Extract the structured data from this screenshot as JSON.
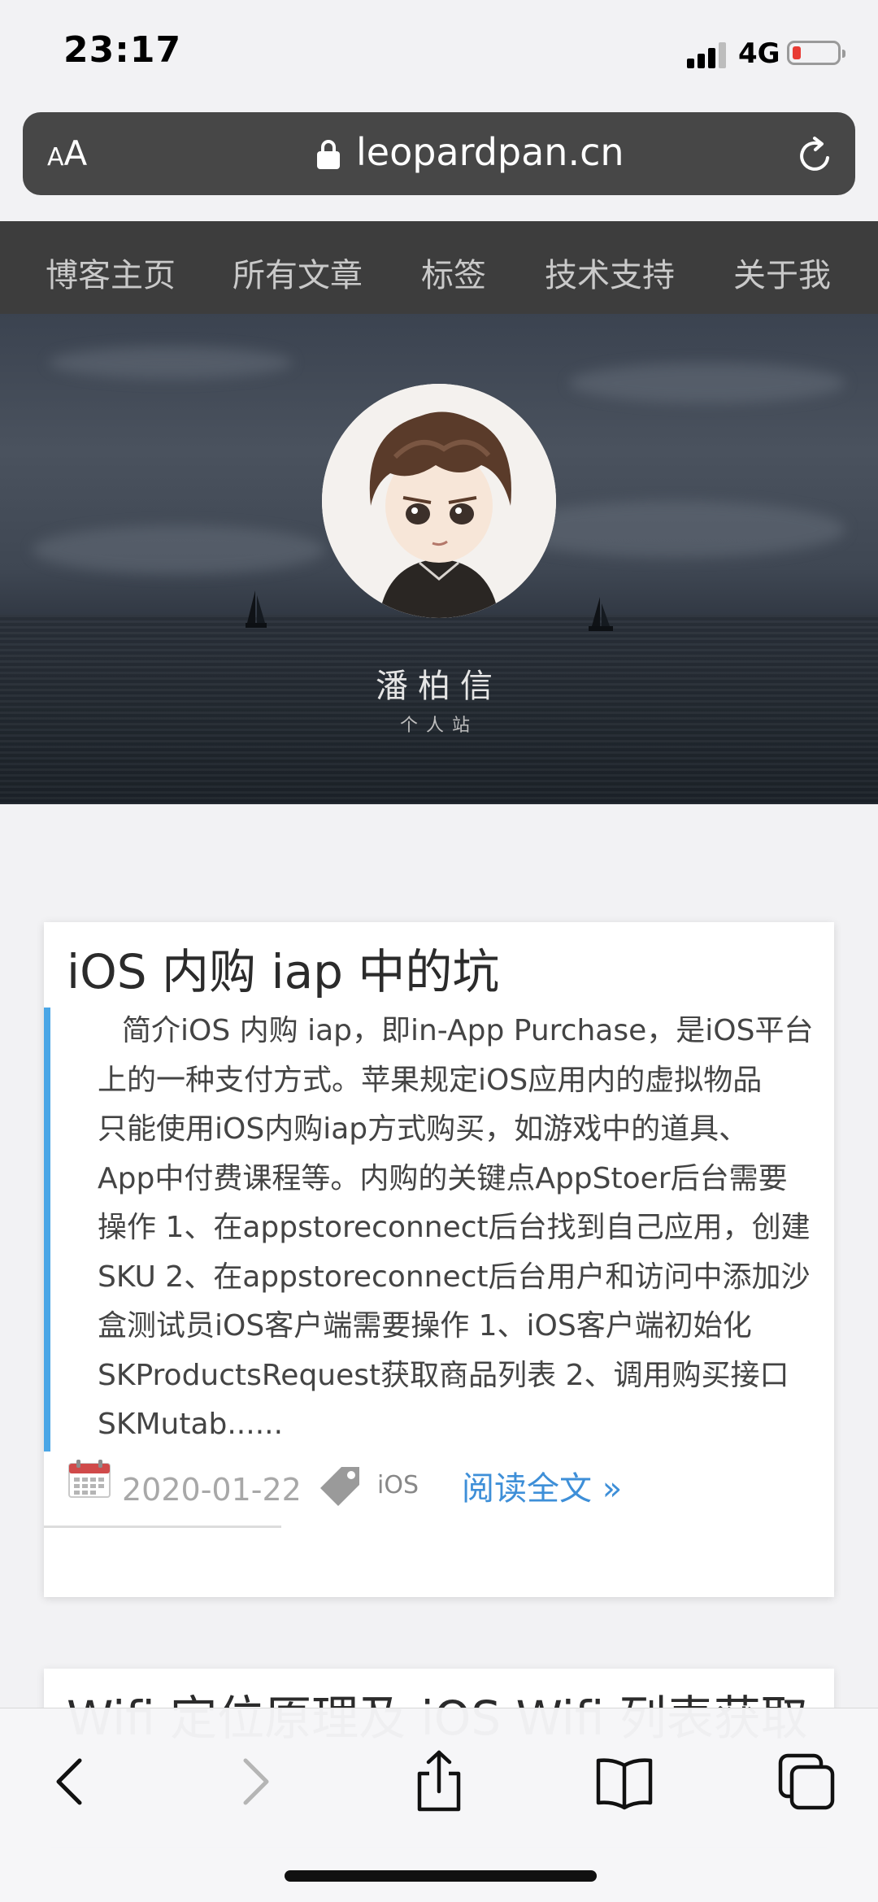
{
  "status_bar": {
    "time": "23:17",
    "network": "4G"
  },
  "browser": {
    "text_size_label": "AA",
    "domain": "leopardpan.cn"
  },
  "blog_nav": {
    "items": [
      "博客主页",
      "所有文章",
      "标签",
      "技术支持",
      "关于我"
    ]
  },
  "hero": {
    "name": "潘柏信",
    "subtitle": "个人站"
  },
  "article": {
    "title": "iOS 内购 iap 中的坑",
    "excerpt_lines": [
      "简介iOS 内购 iap，即in-App Purchase，是iOS平台",
      "上的一种支付方式。苹果规定iOS应用内的虚拟物品",
      "只能使用iOS内购iap方式购买，如游戏中的道具、",
      "App中付费课程等。内购的关键点AppStoer后台需要",
      "操作 1、在appstoreconnect后台找到自己应用，创建",
      "SKU 2、在appstoreconnect后台用户和访问中添加沙",
      "盒测试员iOS客户端需要操作 1、iOS客户端初始化",
      "SKProductsRequest获取商品列表 2、调用购买接口",
      "SKMutab......"
    ],
    "date": "2020-01-22",
    "tag": "iOS",
    "read_more": "阅读全文 »"
  },
  "next_article": {
    "title": "Wifi 定位原理及 iOS Wifi 列表获取"
  },
  "colors": {
    "accent_bar": "#4aa6e6",
    "link": "#3e8fd8",
    "nav_bg": "#3d3d3d",
    "battery_low": "#e83b34"
  },
  "icons": {
    "status": [
      "signal-icon",
      "battery-icon"
    ],
    "browser": [
      "lock-icon",
      "reload-icon"
    ],
    "meta": [
      "calendar-icon",
      "tag-icon"
    ],
    "toolbar": [
      "back-icon",
      "forward-icon",
      "share-icon",
      "bookmarks-icon",
      "tabs-icon"
    ]
  }
}
